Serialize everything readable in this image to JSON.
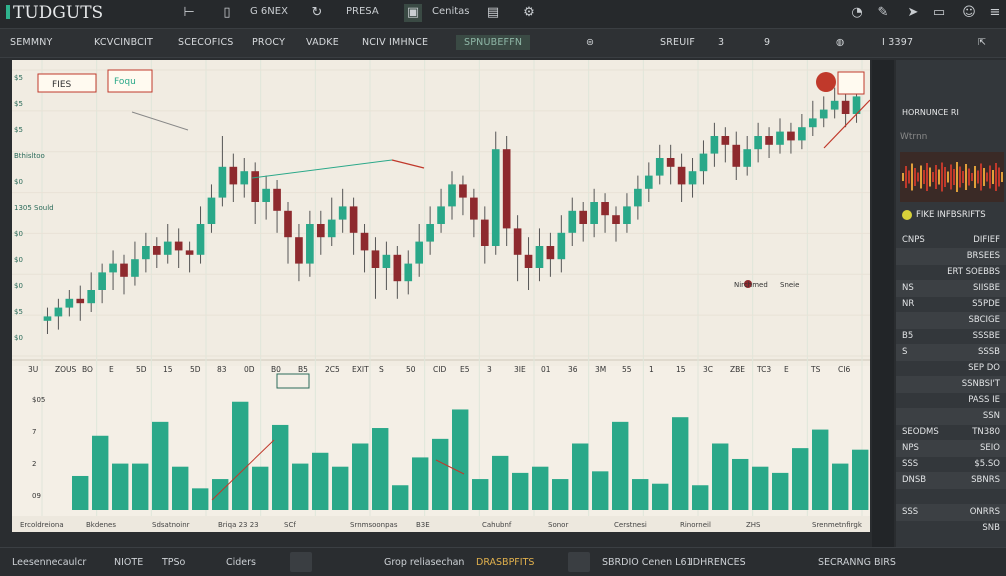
{
  "app": {
    "title": "TUDGUTS"
  },
  "topbar": {
    "items": [
      "G 6NEX",
      "PRESA",
      "Cenitas"
    ]
  },
  "tabs": [
    {
      "label": "SEMMNY"
    },
    {
      "label": "KCVCINBCIT"
    },
    {
      "label": "SCECOFICS"
    },
    {
      "label": "PROCY"
    },
    {
      "label": "VADKE"
    },
    {
      "label": "NCIV IMHNCE"
    },
    {
      "label": "SPNUBEFFN",
      "active": true
    },
    {
      "label": "SREUIF"
    },
    {
      "label": "3"
    },
    {
      "label": "9"
    },
    {
      "label": "I 3397"
    }
  ],
  "chart": {
    "annotations": {
      "box1": "FIES",
      "box2": "Foqu",
      "legend": "Nirchmed",
      "legend2": "Sneie"
    },
    "left_labels": [
      "$5",
      "$5",
      "$5",
      "Bthisltoo",
      "$0",
      "1305 Sould",
      "$0",
      "$0",
      "$0",
      "$5",
      "$0"
    ],
    "x_labels": [
      "3U",
      "ZOUS",
      "BO",
      "E",
      "5D",
      "15",
      "5D",
      "83",
      "0D",
      "B0",
      "B5",
      "2C5",
      "EXIT",
      "S",
      "50",
      "CID",
      "E5",
      "3",
      "3IE",
      "01",
      "36",
      "3M",
      "55",
      "1",
      "15",
      "3C",
      "ZBE",
      "TC3",
      "E",
      "TS",
      "CI6"
    ],
    "vol_labels": [
      "$05",
      "7",
      "2",
      "09"
    ],
    "bottom_labels": [
      "Ercoldreiona",
      "Bkdenes",
      "Sdsatnoinr",
      "Briqa 23 23",
      "SCf",
      "Srnmsoonpas",
      "B3E",
      "Cahubnf",
      "Sonor",
      "Cerstnesi",
      "Rinorneil",
      "ZHS",
      "Srenmetnfirgk"
    ]
  },
  "chart_data": {
    "type": "candlestick",
    "candles": [
      {
        "o": 73,
        "c": 74,
        "h": 76,
        "l": 70
      },
      {
        "o": 74,
        "c": 76,
        "h": 78,
        "l": 71
      },
      {
        "o": 76,
        "c": 78,
        "h": 80,
        "l": 74
      },
      {
        "o": 78,
        "c": 77,
        "h": 81,
        "l": 73
      },
      {
        "o": 77,
        "c": 80,
        "h": 84,
        "l": 75
      },
      {
        "o": 80,
        "c": 84,
        "h": 86,
        "l": 77
      },
      {
        "o": 84,
        "c": 86,
        "h": 89,
        "l": 80
      },
      {
        "o": 86,
        "c": 83,
        "h": 88,
        "l": 79
      },
      {
        "o": 83,
        "c": 87,
        "h": 91,
        "l": 81
      },
      {
        "o": 87,
        "c": 90,
        "h": 93,
        "l": 84
      },
      {
        "o": 90,
        "c": 88,
        "h": 92,
        "l": 85
      },
      {
        "o": 88,
        "c": 91,
        "h": 95,
        "l": 86
      },
      {
        "o": 91,
        "c": 89,
        "h": 94,
        "l": 85
      },
      {
        "o": 89,
        "c": 88,
        "h": 91,
        "l": 84
      },
      {
        "o": 88,
        "c": 95,
        "h": 99,
        "l": 86
      },
      {
        "o": 95,
        "c": 101,
        "h": 104,
        "l": 93
      },
      {
        "o": 101,
        "c": 108,
        "h": 115,
        "l": 99
      },
      {
        "o": 108,
        "c": 104,
        "h": 111,
        "l": 100
      },
      {
        "o": 104,
        "c": 107,
        "h": 110,
        "l": 101
      },
      {
        "o": 107,
        "c": 100,
        "h": 109,
        "l": 95
      },
      {
        "o": 100,
        "c": 103,
        "h": 106,
        "l": 96
      },
      {
        "o": 103,
        "c": 98,
        "h": 105,
        "l": 93
      },
      {
        "o": 98,
        "c": 92,
        "h": 100,
        "l": 86
      },
      {
        "o": 92,
        "c": 86,
        "h": 95,
        "l": 82
      },
      {
        "o": 86,
        "c": 95,
        "h": 98,
        "l": 83
      },
      {
        "o": 95,
        "c": 92,
        "h": 98,
        "l": 88
      },
      {
        "o": 92,
        "c": 96,
        "h": 101,
        "l": 90
      },
      {
        "o": 96,
        "c": 99,
        "h": 103,
        "l": 93
      },
      {
        "o": 99,
        "c": 93,
        "h": 101,
        "l": 88
      },
      {
        "o": 93,
        "c": 89,
        "h": 95,
        "l": 84
      },
      {
        "o": 89,
        "c": 85,
        "h": 92,
        "l": 78
      },
      {
        "o": 85,
        "c": 88,
        "h": 91,
        "l": 80
      },
      {
        "o": 88,
        "c": 82,
        "h": 90,
        "l": 78
      },
      {
        "o": 82,
        "c": 86,
        "h": 89,
        "l": 79
      },
      {
        "o": 86,
        "c": 91,
        "h": 95,
        "l": 83
      },
      {
        "o": 91,
        "c": 95,
        "h": 99,
        "l": 88
      },
      {
        "o": 95,
        "c": 99,
        "h": 103,
        "l": 93
      },
      {
        "o": 99,
        "c": 104,
        "h": 107,
        "l": 96
      },
      {
        "o": 104,
        "c": 101,
        "h": 106,
        "l": 97
      },
      {
        "o": 101,
        "c": 96,
        "h": 103,
        "l": 92
      },
      {
        "o": 96,
        "c": 90,
        "h": 99,
        "l": 86
      },
      {
        "o": 90,
        "c": 112,
        "h": 116,
        "l": 88
      },
      {
        "o": 112,
        "c": 94,
        "h": 115,
        "l": 90
      },
      {
        "o": 94,
        "c": 88,
        "h": 97,
        "l": 82
      },
      {
        "o": 88,
        "c": 85,
        "h": 92,
        "l": 80
      },
      {
        "o": 85,
        "c": 90,
        "h": 94,
        "l": 82
      },
      {
        "o": 90,
        "c": 87,
        "h": 93,
        "l": 83
      },
      {
        "o": 87,
        "c": 93,
        "h": 97,
        "l": 84
      },
      {
        "o": 93,
        "c": 98,
        "h": 101,
        "l": 90
      },
      {
        "o": 98,
        "c": 95,
        "h": 100,
        "l": 91
      },
      {
        "o": 95,
        "c": 100,
        "h": 103,
        "l": 92
      },
      {
        "o": 100,
        "c": 97,
        "h": 102,
        "l": 93
      },
      {
        "o": 97,
        "c": 95,
        "h": 99,
        "l": 91
      },
      {
        "o": 95,
        "c": 99,
        "h": 102,
        "l": 93
      },
      {
        "o": 99,
        "c": 103,
        "h": 106,
        "l": 96
      },
      {
        "o": 103,
        "c": 106,
        "h": 109,
        "l": 100
      },
      {
        "o": 106,
        "c": 110,
        "h": 113,
        "l": 104
      },
      {
        "o": 110,
        "c": 108,
        "h": 113,
        "l": 104
      },
      {
        "o": 108,
        "c": 104,
        "h": 111,
        "l": 100
      },
      {
        "o": 104,
        "c": 107,
        "h": 110,
        "l": 101
      },
      {
        "o": 107,
        "c": 111,
        "h": 114,
        "l": 104
      },
      {
        "o": 111,
        "c": 115,
        "h": 118,
        "l": 108
      },
      {
        "o": 115,
        "c": 113,
        "h": 117,
        "l": 109
      },
      {
        "o": 113,
        "c": 108,
        "h": 116,
        "l": 105
      },
      {
        "o": 108,
        "c": 112,
        "h": 115,
        "l": 106
      },
      {
        "o": 112,
        "c": 115,
        "h": 118,
        "l": 109
      },
      {
        "o": 115,
        "c": 113,
        "h": 117,
        "l": 110
      },
      {
        "o": 113,
        "c": 116,
        "h": 119,
        "l": 111
      },
      {
        "o": 116,
        "c": 114,
        "h": 118,
        "l": 111
      },
      {
        "o": 114,
        "c": 117,
        "h": 120,
        "l": 112
      },
      {
        "o": 117,
        "c": 119,
        "h": 123,
        "l": 115
      },
      {
        "o": 119,
        "c": 121,
        "h": 124,
        "l": 117
      },
      {
        "o": 121,
        "c": 123,
        "h": 126,
        "l": 119
      },
      {
        "o": 123,
        "c": 120,
        "h": 125,
        "l": 117
      },
      {
        "o": 120,
        "c": 124,
        "h": 127,
        "l": 118
      }
    ],
    "volume": [
      22,
      48,
      30,
      30,
      57,
      28,
      14,
      20,
      70,
      28,
      55,
      30,
      37,
      28,
      43,
      53,
      16,
      34,
      46,
      65,
      20,
      35,
      24,
      28,
      20,
      43,
      25,
      57,
      20,
      17,
      60,
      16,
      43,
      33,
      28,
      24,
      40,
      52,
      30,
      39
    ]
  },
  "right_panel": {
    "header": "HORNUNCE RI",
    "subheader": "Wtrnn",
    "legend": "FIKE INFBSRIFTS",
    "rows": [
      {
        "l": "CNPS",
        "r": "DIFIEF"
      },
      {
        "l": "",
        "r": "BRSEES"
      },
      {
        "l": "",
        "r": "ERT SOEBBS"
      },
      {
        "l": "NS",
        "r": "SIISBE"
      },
      {
        "l": "NR",
        "r": "S5PDE"
      },
      {
        "l": "",
        "r": "SBCIGE"
      },
      {
        "l": "B5",
        "r": "SSSBE"
      },
      {
        "l": "S",
        "r": "SSSB"
      },
      {
        "l": "",
        "r": "SEP DO"
      },
      {
        "l": "",
        "r": "SSNBSI'T"
      },
      {
        "l": "",
        "r": "PASS IE"
      },
      {
        "l": "",
        "r": "SSN"
      },
      {
        "l": "SEODMS",
        "r": "TN380"
      },
      {
        "l": "NPS",
        "r": "SEIO"
      },
      {
        "l": "SSS",
        "r": "$5.SO"
      },
      {
        "l": "DNSB",
        "r": "SBNRS"
      },
      {
        "l": "",
        "r": ""
      },
      {
        "l": "SSS",
        "r": "ONRRS"
      },
      {
        "l": "",
        "r": "SNB"
      }
    ]
  },
  "bottombar": {
    "items": [
      "Leesennecaulcr",
      "NIOTE",
      "TPSo",
      "Ciders",
      "Grop reliasechan",
      "DRASBPFITS",
      "SBRDIO Cenen L61",
      "IDHRENCES",
      "SECRANNG BIRS"
    ]
  },
  "colors": {
    "bull": "#2aa889",
    "bear": "#8e2a2e",
    "bg_chart": "#f1ece2",
    "grid": "#dfe6da"
  }
}
